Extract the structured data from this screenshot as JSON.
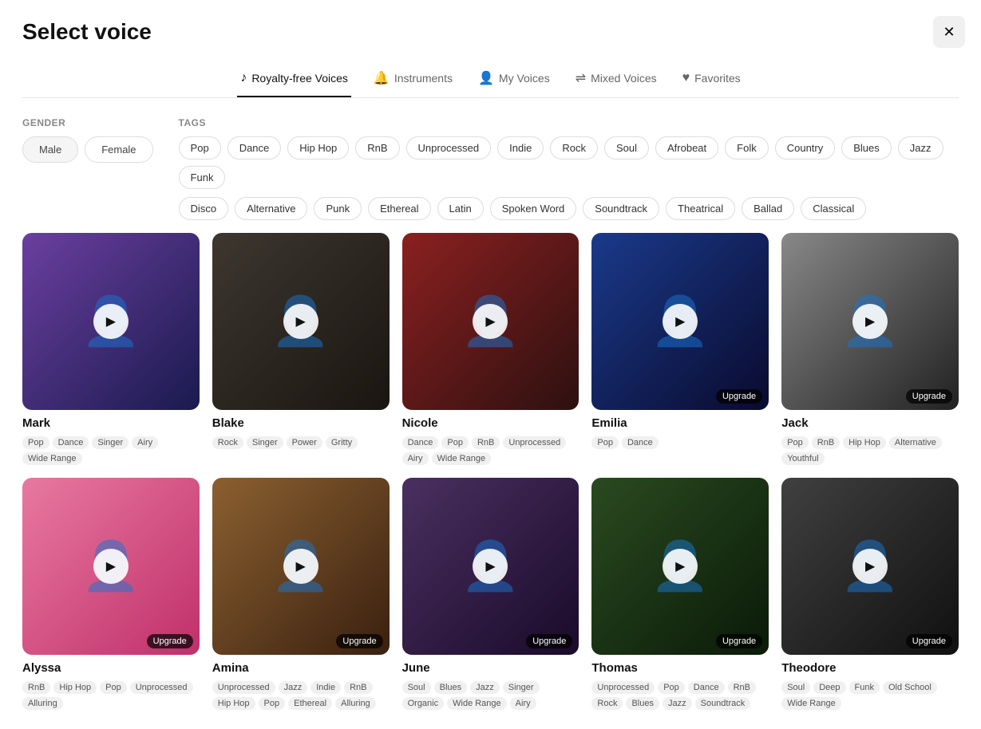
{
  "page": {
    "title": "Select voice"
  },
  "close_btn": "✕",
  "tabs": [
    {
      "id": "royalty-free",
      "label": "Royalty-free Voices",
      "icon": "♪",
      "active": true
    },
    {
      "id": "instruments",
      "label": "Instruments",
      "icon": "🔔",
      "active": false
    },
    {
      "id": "my-voices",
      "label": "My Voices",
      "icon": "👤",
      "active": false
    },
    {
      "id": "mixed-voices",
      "label": "Mixed Voices",
      "icon": "⇌",
      "active": false
    },
    {
      "id": "favorites",
      "label": "Favorites",
      "icon": "♥",
      "active": false
    }
  ],
  "gender_filter": {
    "label": "GENDER",
    "options": [
      "Male",
      "Female"
    ]
  },
  "tags_filter": {
    "label": "TAGS",
    "row1": [
      "Pop",
      "Dance",
      "Hip Hop",
      "RnB",
      "Unprocessed",
      "Indie",
      "Rock",
      "Soul",
      "Afrobeat",
      "Folk",
      "Country",
      "Blues",
      "Jazz",
      "Funk"
    ],
    "row2": [
      "Disco",
      "Alternative",
      "Punk",
      "Ethereal",
      "Latin",
      "Spoken Word",
      "Soundtrack",
      "Theatrical",
      "Ballad",
      "Classical"
    ]
  },
  "voices": [
    {
      "id": "mark",
      "name": "Mark",
      "bg_class": "card-bg-mark",
      "tags": [
        "Pop",
        "Dance",
        "Singer",
        "Airy",
        "Wide Range"
      ],
      "upgrade": false
    },
    {
      "id": "blake",
      "name": "Blake",
      "bg_class": "card-bg-blake",
      "tags": [
        "Rock",
        "Singer",
        "Power",
        "Gritty"
      ],
      "upgrade": false
    },
    {
      "id": "nicole",
      "name": "Nicole",
      "bg_class": "card-bg-nicole",
      "tags": [
        "Dance",
        "Pop",
        "RnB",
        "Unprocessed",
        "Airy",
        "Wide Range"
      ],
      "upgrade": false
    },
    {
      "id": "emilia",
      "name": "Emilia",
      "bg_class": "card-bg-emilia",
      "tags": [
        "Pop",
        "Dance"
      ],
      "upgrade": true
    },
    {
      "id": "jack",
      "name": "Jack",
      "bg_class": "card-bg-jack",
      "tags": [
        "Pop",
        "RnB",
        "Hip Hop",
        "Alternative",
        "Youthful"
      ],
      "upgrade": true
    },
    {
      "id": "alyssa",
      "name": "Alyssa",
      "bg_class": "card-bg-alyssa",
      "tags": [
        "RnB",
        "Hip Hop",
        "Pop",
        "Unprocessed",
        "Alluring"
      ],
      "upgrade": true
    },
    {
      "id": "amina",
      "name": "Amina",
      "bg_class": "card-bg-amina",
      "tags": [
        "Unprocessed",
        "Jazz",
        "Indie",
        "RnB",
        "Hip Hop",
        "Pop",
        "Ethereal",
        "Alluring"
      ],
      "upgrade": true
    },
    {
      "id": "june",
      "name": "June",
      "bg_class": "card-bg-june",
      "tags": [
        "Soul",
        "Blues",
        "Jazz",
        "Singer",
        "Organic",
        "Wide Range",
        "Airy"
      ],
      "upgrade": true
    },
    {
      "id": "thomas",
      "name": "Thomas",
      "bg_class": "card-bg-thomas",
      "tags": [
        "Unprocessed",
        "Pop",
        "Dance",
        "RnB",
        "Rock",
        "Blues",
        "Jazz",
        "Soundtrack"
      ],
      "upgrade": true
    },
    {
      "id": "theodore",
      "name": "Theodore",
      "bg_class": "card-bg-theodore",
      "tags": [
        "Soul",
        "Deep",
        "Funk",
        "Old School",
        "Wide Range"
      ],
      "upgrade": true
    }
  ],
  "upgrade_label": "Upgrade",
  "play_icon": "▶"
}
